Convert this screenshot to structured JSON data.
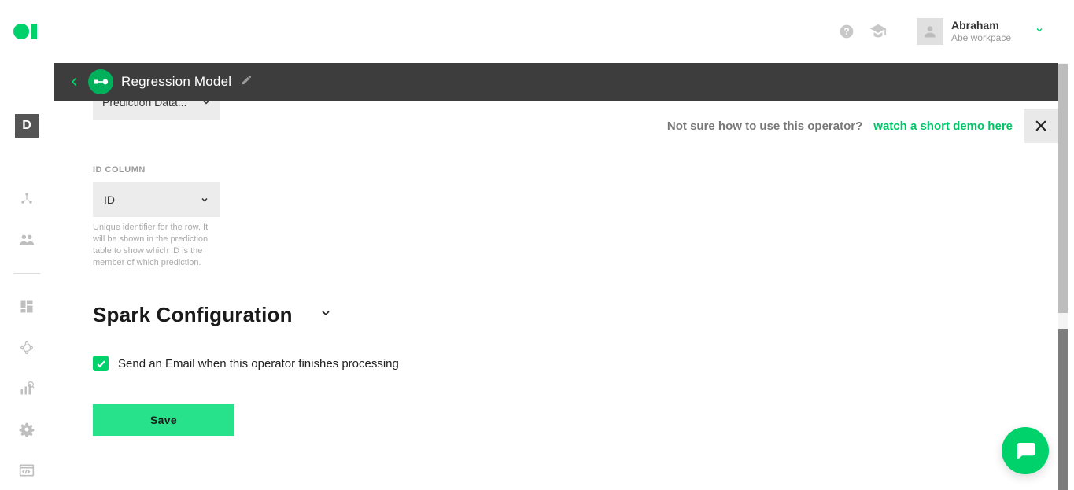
{
  "header": {
    "user_name": "Abraham",
    "user_workspace": "Abe workpace"
  },
  "subheader": {
    "title": "Regression Model"
  },
  "nav": {
    "badge": "D"
  },
  "hint": {
    "text": "Not sure how to use this operator?",
    "link": "watch a short demo here"
  },
  "form": {
    "prediction_dropdown": "Prediction Data...",
    "id_label": "ID COLUMN",
    "id_value": "ID",
    "id_helper": "Unique identifier for the row. It will be shown in the prediction table to show which ID is the member of which prediction.",
    "section_spark": "Spark Configuration",
    "email_checkbox_label": "Send an Email when this operator finishes processing",
    "save_label": "Save"
  }
}
